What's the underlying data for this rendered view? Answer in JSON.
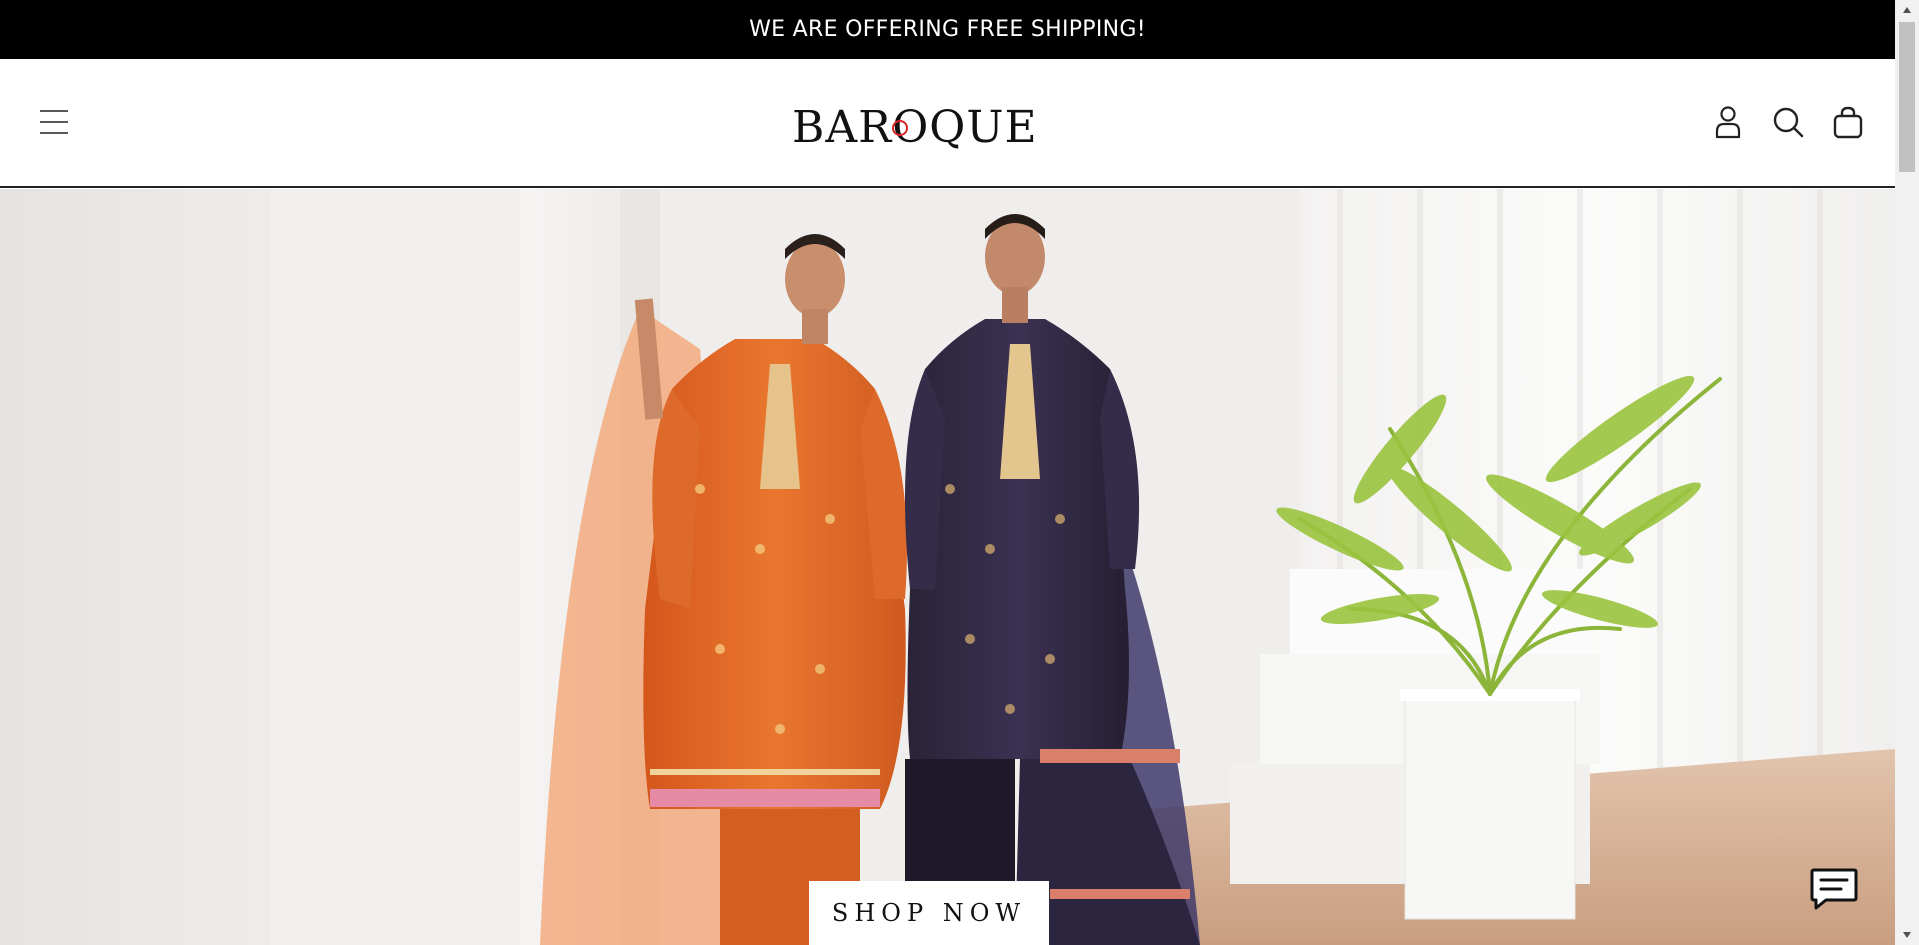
{
  "announcement": {
    "text": "WE ARE OFFERING FREE SHIPPING!"
  },
  "header": {
    "logo_text": "BAROQUE",
    "icons": [
      "menu-icon",
      "account-icon",
      "search-icon",
      "bag-icon"
    ]
  },
  "hero": {
    "cta_label": "SHOP NOW"
  },
  "chat": {
    "icon": "chat-icon"
  },
  "colors": {
    "announcement_bg": "#000000",
    "announcement_text": "#ffffff",
    "logo_accent": "#d8232a",
    "header_border": "#222222",
    "orange_outfit": "#e06a28",
    "purple_outfit": "#2e2742"
  }
}
